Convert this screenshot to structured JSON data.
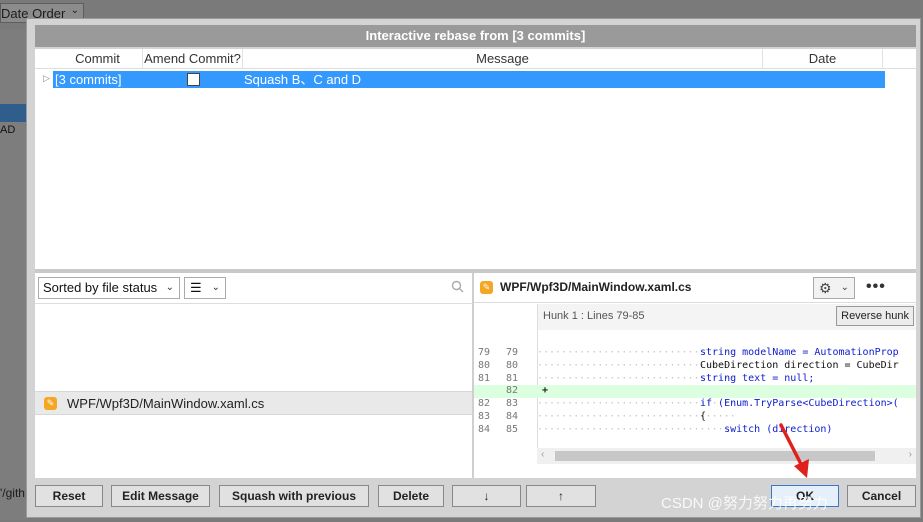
{
  "background": {
    "dropdown_label": "Date Order",
    "head_label": "AD",
    "path_fragment": "'/gith"
  },
  "dialog": {
    "title": "Interactive rebase from [3 commits]",
    "columns": [
      "Commit",
      "Amend Commit?",
      "Message",
      "Date"
    ],
    "rows": [
      {
        "commit": "[3 commits]",
        "amend": false,
        "message": "Squash B、C and D",
        "date": ""
      }
    ]
  },
  "file_pane": {
    "sort_label": "Sorted by file status",
    "view_icon": "list-icon",
    "files": [
      {
        "icon": "modified-file-icon",
        "path": "WPF/Wpf3D/MainWindow.xaml.cs"
      }
    ]
  },
  "diff_pane": {
    "file_title": "WPF/Wpf3D/MainWindow.xaml.cs",
    "hunk_label": "Hunk 1 : Lines 79-85",
    "reverse_hunk_label": "Reverse hunk",
    "lines": [
      {
        "old": "79",
        "new": "79",
        "code": "string modelName = AutomationProp"
      },
      {
        "old": "80",
        "new": "80",
        "code": "CubeDirection direction = CubeDir"
      },
      {
        "old": "81",
        "new": "81",
        "code": "string text = null;"
      },
      {
        "old": "",
        "new": "82",
        "code": "",
        "added": true,
        "marker": "+"
      },
      {
        "old": "82",
        "new": "83",
        "code": "if (Enum.TryParse<CubeDirection>("
      },
      {
        "old": "83",
        "new": "84",
        "code": "{"
      },
      {
        "old": "84",
        "new": "85",
        "code": "    switch (direction)"
      }
    ]
  },
  "buttons": {
    "reset": "Reset",
    "edit_message": "Edit Message",
    "squash": "Squash with previous",
    "delete": "Delete",
    "move_down": "↓",
    "move_up": "↑",
    "ok": "OK",
    "cancel": "Cancel"
  },
  "watermark": "CSDN @努力努力再努力",
  "colors": {
    "selection": "#3399ff",
    "added_line": "#dcffe0",
    "keyword": "#1020d0",
    "annotation_arrow": "#e0201e"
  }
}
